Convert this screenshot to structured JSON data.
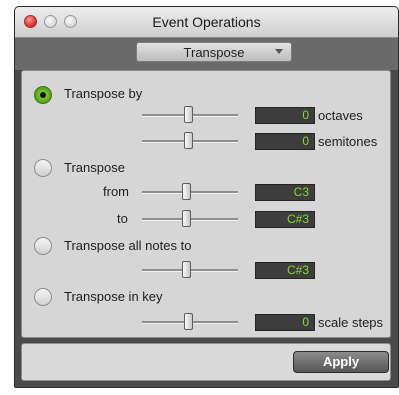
{
  "window": {
    "title": "Event Operations"
  },
  "toolbar": {
    "operation": "Transpose"
  },
  "options": {
    "transpose_by": {
      "label": "Transpose by",
      "selected": true,
      "octaves": {
        "value": "0",
        "unit": "octaves"
      },
      "semitones": {
        "value": "0",
        "unit": "semitones"
      }
    },
    "transpose_range": {
      "label": "Transpose",
      "selected": false,
      "from": {
        "label": "from",
        "value": "C3"
      },
      "to": {
        "label": "to",
        "value": "C#3"
      }
    },
    "transpose_all": {
      "label": "Transpose all notes to",
      "selected": false,
      "value": "C#3"
    },
    "transpose_key": {
      "label": "Transpose in key",
      "selected": false,
      "value": "0",
      "unit": "scale steps"
    }
  },
  "footer": {
    "apply_label": "Apply"
  },
  "colors": {
    "value_text": "#8bd92a",
    "value_bg": "#3d3d3d",
    "radio_selected": "#7cc527"
  }
}
